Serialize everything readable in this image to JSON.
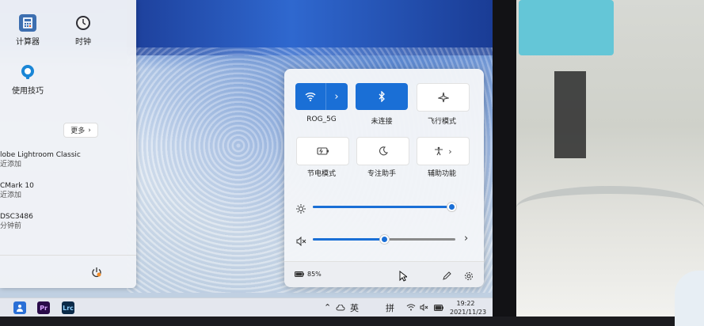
{
  "start_menu": {
    "pinned": [
      {
        "label": "计算器",
        "icon": "calculator-icon"
      },
      {
        "label": "时钟",
        "icon": "clock-icon"
      },
      {
        "label": "使用技巧",
        "icon": "tips-icon"
      }
    ],
    "more_label": "更多",
    "recent": [
      {
        "title": "lobe Lightroom Classic",
        "sub": "近添加"
      },
      {
        "title": "CMark 10",
        "sub": "近添加"
      },
      {
        "title": "DSC3486",
        "sub": "分钟前"
      }
    ]
  },
  "quick_settings": {
    "tiles": [
      {
        "label": "ROG_5G",
        "icon": "wifi-icon",
        "state": "on"
      },
      {
        "label": "未连接",
        "icon": "bluetooth-icon",
        "state": "on"
      },
      {
        "label": "飞行模式",
        "icon": "airplane-icon",
        "state": "off"
      },
      {
        "label": "节电模式",
        "icon": "battery-saver-icon",
        "state": "off"
      },
      {
        "label": "专注助手",
        "icon": "moon-icon",
        "state": "off"
      },
      {
        "label": "辅助功能",
        "icon": "accessibility-icon",
        "state": "off"
      }
    ],
    "brightness": 1.0,
    "volume": 0.5,
    "battery": "85%"
  },
  "taskbar": {
    "apps": [
      {
        "label": "",
        "icon": "user-app-icon",
        "color": "#2a6fd6"
      },
      {
        "label": "Pr",
        "icon": "premiere-icon",
        "color": "#2a0b4a"
      },
      {
        "label": "Lrc",
        "icon": "lightroom-icon",
        "color": "#0b2a48"
      }
    ],
    "lang1": "英",
    "lang2": "拼",
    "time": "19:22",
    "date": "2021/11/23"
  },
  "colors": {
    "accent": "#1a6fd6"
  }
}
